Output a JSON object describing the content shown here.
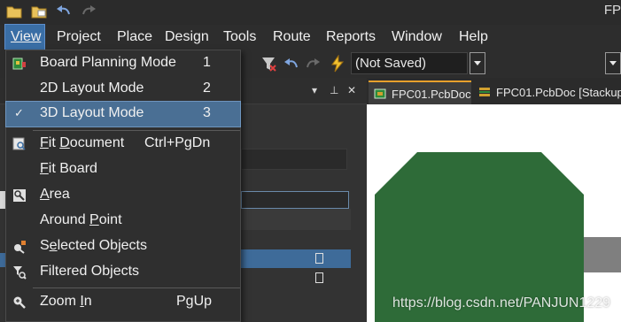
{
  "app": {
    "title": "FP"
  },
  "menubar": {
    "items": [
      "View",
      "Project",
      "Place",
      "Design",
      "Tools",
      "Route",
      "Reports",
      "Window",
      "Help"
    ]
  },
  "toolbar": {
    "save_state": "(Not Saved)"
  },
  "tabs": [
    {
      "label": "FPC01.PcbDoc"
    },
    {
      "label": "FPC01.PcbDoc [Stackup"
    }
  ],
  "view_menu": {
    "items": [
      {
        "label": "Board Planning Mode",
        "shortcut": "1",
        "icon": "board-planning-icon"
      },
      {
        "label": "2D Layout Mode",
        "shortcut": "2",
        "icon": ""
      },
      {
        "label": "3D Layout Mode",
        "shortcut": "3",
        "icon": "check-icon",
        "checked": true
      },
      {
        "label": "Fit Document",
        "shortcut": "Ctrl+PgDn",
        "icon": "fit-document-icon"
      },
      {
        "label": "Fit Board",
        "shortcut": "",
        "icon": ""
      },
      {
        "label": "Area",
        "shortcut": "",
        "icon": "zoom-area-icon"
      },
      {
        "label": "Around Point",
        "shortcut": "",
        "icon": ""
      },
      {
        "label": "Selected Objects",
        "shortcut": "",
        "icon": "selected-objects-icon"
      },
      {
        "label": "Filtered Objects",
        "shortcut": "",
        "icon": "filtered-objects-icon"
      },
      {
        "label": "Zoom In",
        "shortcut": "PgUp",
        "icon": "zoom-in-icon"
      }
    ]
  },
  "watermark": "https://blog.csdn.net/PANJUN1229",
  "colors": {
    "menu_active": "#3a6ea5",
    "checked_item": "#4a6f94",
    "board": "#2e6b38",
    "tab_accent": "#e8a02c"
  }
}
